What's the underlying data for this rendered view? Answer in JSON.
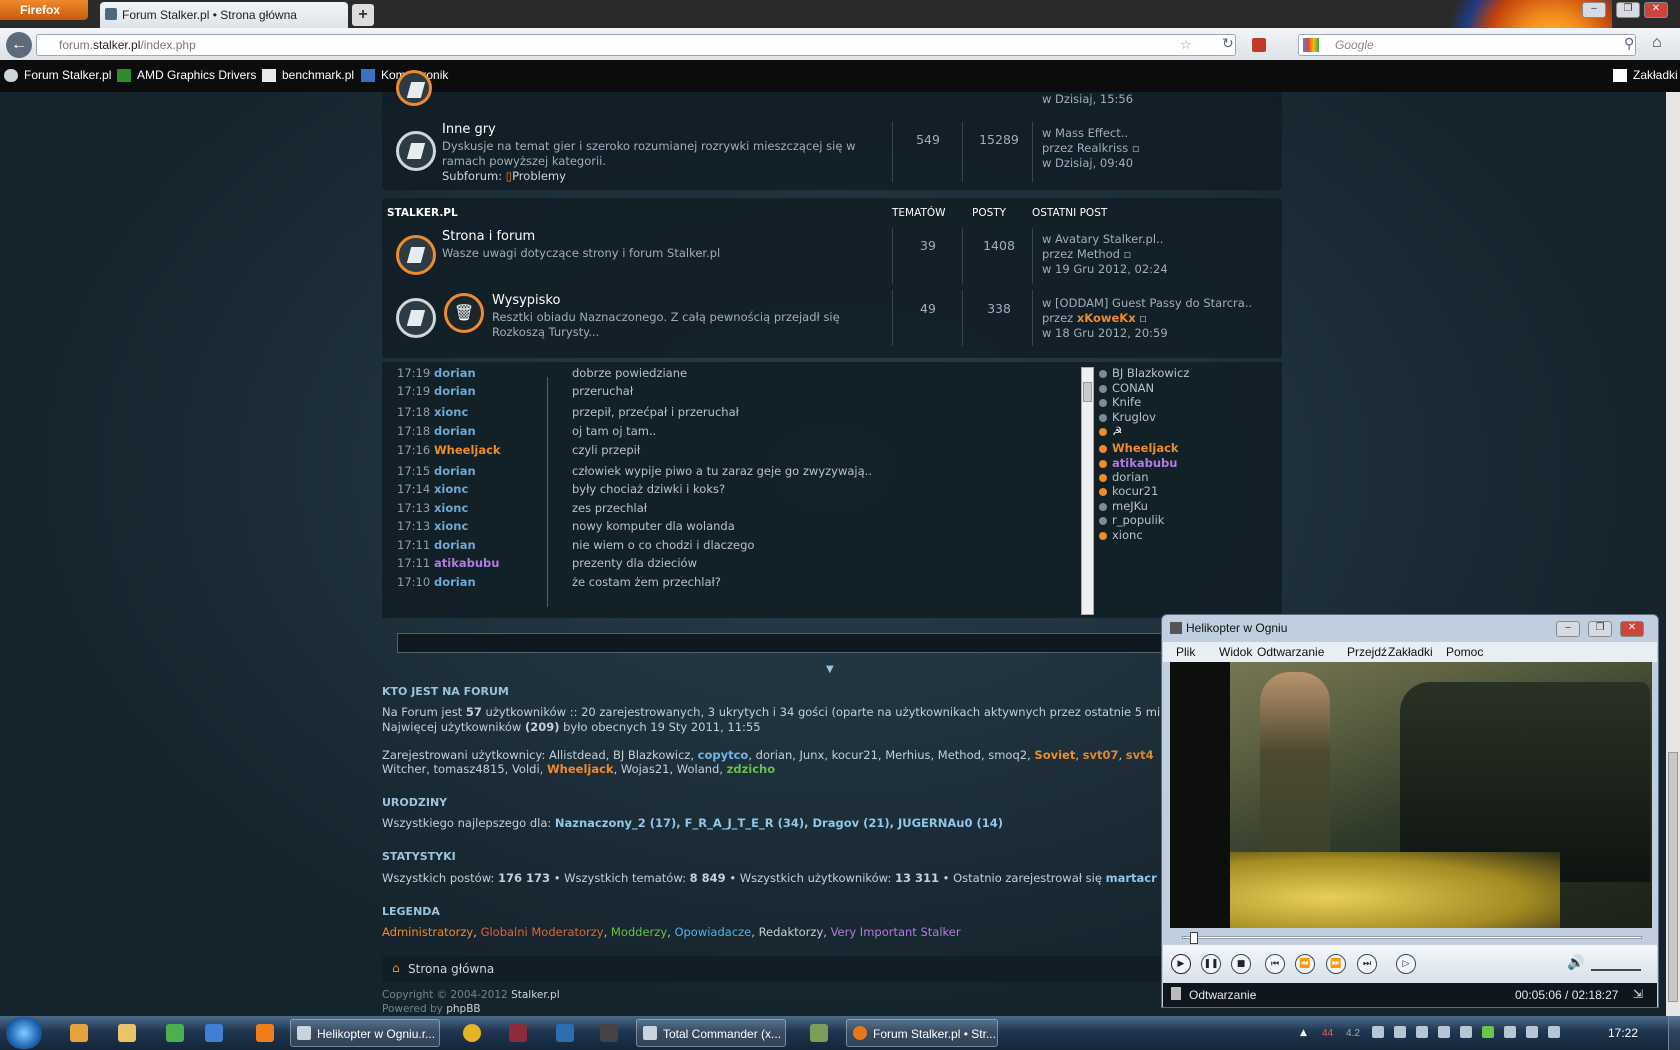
{
  "browser": {
    "app_button": "Firefox",
    "tab_title": "Forum Stalker.pl • Strona główna",
    "new_tab": "+",
    "url_prefix": "forum.",
    "url_domain": "stalker.pl",
    "url_path": "/index.php",
    "search_placeholder": "Google",
    "bookmarks": [
      "Forum Stalker.pl",
      "AMD Graphics Drivers",
      "benchmark.pl",
      "Komputronik"
    ],
    "bookmarks_menu": "Zakładki"
  },
  "forum": {
    "prev_row_last": "w Dzisiaj, 15:56",
    "inne_gry": {
      "title": "Inne gry",
      "desc_1": "Dyskusje na temat gier i szeroko rozumianej rozrywki mieszczącej się w",
      "desc_2": "ramach powyższej kategorii.",
      "subforum_label": "Subforum:",
      "subforum_link": "Problemy",
      "topics": "549",
      "posts": "15289",
      "last_1": "w Mass Effect..",
      "last_2": "przez Realkriss",
      "last_3": "w Dzisiaj, 09:40"
    },
    "category": {
      "name": "STALKER.PL",
      "col_topics": "TEMATÓW",
      "col_posts": "POSTY",
      "col_last": "OSTATNI POST"
    },
    "strona": {
      "title": "Strona i forum",
      "desc": "Wasze uwagi dotyczące strony i forum Stalker.pl",
      "topics": "39",
      "posts": "1408",
      "last_1": "w Avatary Stalker.pl..",
      "last_2": "przez Method",
      "last_3": "w 19 Gru 2012, 02:24"
    },
    "wysypisko": {
      "title": "Wysypisko",
      "desc_1": "Resztki obiadu Naznaczonego. Z całą pewnością przejadł się",
      "desc_2": "Rozkoszą Turysty...",
      "topics": "49",
      "posts": "338",
      "last_1": "w [ODDAM] Guest Passy do Starcra..",
      "last_2_prefix": "przez",
      "last_2_user": "xKoweKx",
      "last_3": "w 18 Gru 2012, 20:59"
    }
  },
  "chat": {
    "messages": [
      {
        "time": "17:19",
        "user": "dorian",
        "text": "dobrze powiedziane"
      },
      {
        "time": "17:19",
        "user": "dorian",
        "text": "przeruchał"
      },
      {
        "time": "17:18",
        "user": "xionc",
        "text": "przepił, przećpał i przeruchał"
      },
      {
        "time": "17:18",
        "user": "dorian",
        "text": "oj tam oj tam.."
      },
      {
        "time": "17:16",
        "user": "Wheeljack",
        "text": "czyli przepił"
      },
      {
        "time": "17:15",
        "user": "dorian",
        "text": "człowiek wypije piwo a tu zaraz geje go zwyzywają.."
      },
      {
        "time": "17:14",
        "user": "xionc",
        "text": "były chociaż dziwki i koks?"
      },
      {
        "time": "17:13",
        "user": "xionc",
        "text": "zes przechlał"
      },
      {
        "time": "17:13",
        "user": "xionc",
        "text": "nowy komputer dla wolanda"
      },
      {
        "time": "17:11",
        "user": "dorian",
        "text": "nie wiem o co chodzi i dlaczego"
      },
      {
        "time": "17:11",
        "user": "atikabubu",
        "text": "prezenty dla dzieciów"
      },
      {
        "time": "17:10",
        "user": "dorian",
        "text": "że costam żem przechlał?"
      }
    ],
    "users": [
      "BJ Blazkowicz",
      "CONAN",
      "Knife",
      "Kruglov",
      "",
      "Wheeljack",
      "atikabubu",
      "dorian",
      "kocur21",
      "meJKu",
      "r_populik",
      "xionc"
    ],
    "colors": {
      "admin": "#ef8b2a",
      "mod": "#b07be0",
      "default": "#6fa9d3"
    }
  },
  "who": {
    "heading": "KTO JEST NA FORUM",
    "line1_a": "Na Forum jest",
    "line1_count": "57",
    "line1_b": "użytkowników :: 20 zarejestrowanych, 3 ukrytych i 34 gości (oparte na użytkownikach aktywnych przez ostatnie 5 mi",
    "line2_a": "Najwięcej użytkowników",
    "line2_count": "(209)",
    "line2_b": "było obecnych 19 Sty 2011, 11:55",
    "registered_label": "Zarejestrowani użytkownicy:",
    "reg_1": "Allistdead, BJ Blazkowicz,",
    "reg_copytco": "copytco",
    "reg_2": ", dorian, Junx, kocur21, Merhius, Method, smoq2,",
    "reg_soviet": "Soviet",
    "reg_svt07": "svt07",
    "reg_svt4": "svt4",
    "reg_3": "Witcher, tomasz4815, Voldi,",
    "reg_wheeljack": "Wheeljack",
    "reg_4": ", Wojas21, Woland,",
    "reg_zdzicho": "zdzicho"
  },
  "birthdays": {
    "heading": "URODZINY",
    "label": "Wszystkiego najlepszego dla:",
    "list": "Naznaczony_2 (17), F_R_A_J_T_E_R (34), Dragov (21), JUGERNAu0 (14)"
  },
  "stats": {
    "heading": "STATYSTYKI",
    "posts_label": "Wszystkich postów:",
    "posts": "176 173",
    "topics_label": "• Wszystkich tematów:",
    "topics": "8 849",
    "users_label": "• Wszystkich użytkowników:",
    "users": "13 311",
    "newest_label": "• Ostatnio zarejestrował się",
    "newest": "martacr"
  },
  "legend": {
    "heading": "LEGENDA",
    "admins": "Administratorzy",
    "gmods": "Globalni Moderatorzy",
    "modders": "Modderzy",
    "storytellers": "Opowiadacze",
    "editors": "Redaktorzy",
    "vis": "Very Important Stalker"
  },
  "footer": {
    "home": "Strona główna",
    "copyright_a": "Copyright © 2004-2012",
    "copyright_b": "Stalker.pl",
    "powered_a": "Powered by",
    "powered_b": "phpBB"
  },
  "player": {
    "title": "Helikopter w Ogniu",
    "menu": [
      "Plik",
      "Widok",
      "Odtwarzanie",
      "Przejdź",
      "Zakładki",
      "Pomoc"
    ],
    "status": "Odtwarzanie",
    "time": "00:05:06 / 02:18:27"
  },
  "taskbar": {
    "tasks": [
      "Helikopter w Ogniu.r...",
      "Total Commander (x...",
      "Forum Stalker.pl • Str..."
    ],
    "clock": "17:22",
    "tray_nums": [
      "44",
      "4.2"
    ]
  }
}
